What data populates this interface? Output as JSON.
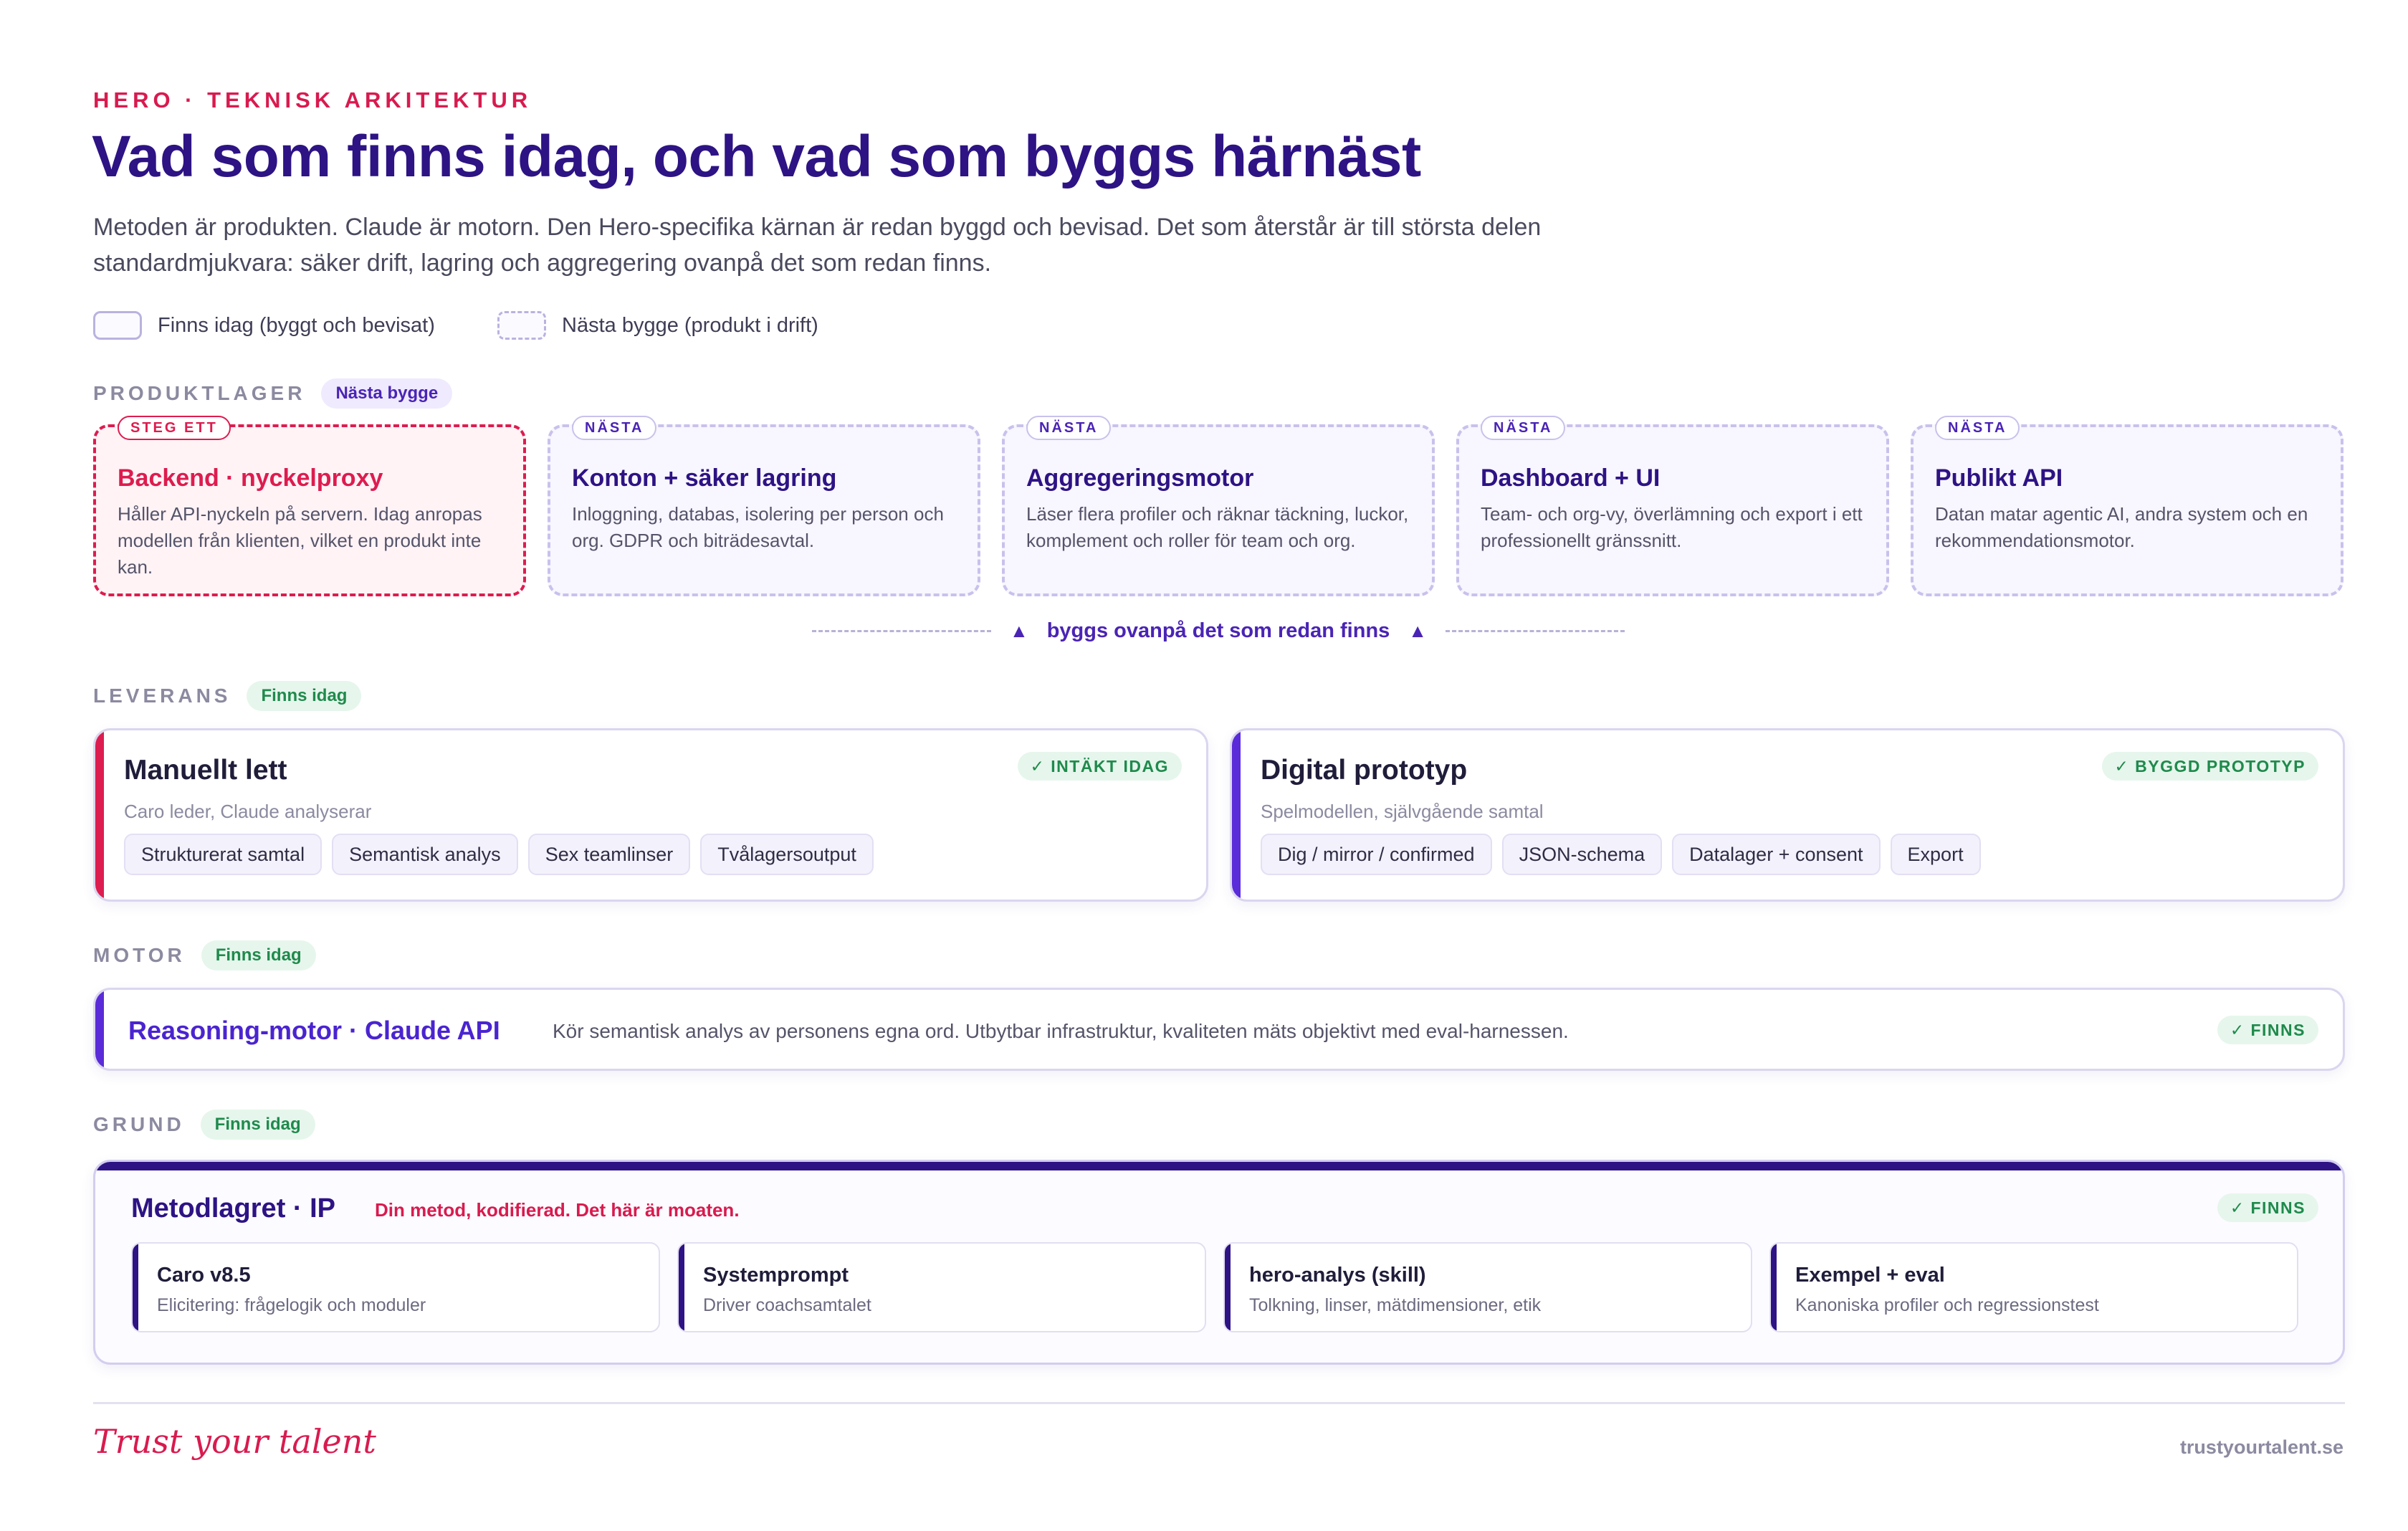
{
  "header": {
    "eyebrow": "HERO · TEKNISK ARKITEKTUR",
    "title": "Vad som finns idag, och vad som byggs härnäst",
    "lead": "Metoden är produkten. Claude är motorn. Den Hero-specifika kärnan är redan byggd och bevisad. Det som återstår är till största delen standardmjukvara: säker drift, lagring och aggregering ovanpå det som redan finns."
  },
  "legend": {
    "exists": "Finns idag (byggt och bevisat)",
    "next": "Nästa bygge (produkt i drift)"
  },
  "product_layer": {
    "label": "PRODUKTLAGER",
    "pill": "Nästa bygge",
    "cards": [
      {
        "tag": "STEG ETT",
        "title": "Backend · nyckelproxy",
        "desc": "Håller API-nyckeln på servern. Idag anropas modellen från klienten, vilket en produkt inte kan."
      },
      {
        "tag": "NÄSTA",
        "title": "Konton + säker lagring",
        "desc": "Inloggning, databas, isolering per person och org. GDPR och biträdesavtal."
      },
      {
        "tag": "NÄSTA",
        "title": "Aggregeringsmotor",
        "desc": "Läser flera profiler och räknar täckning, luckor, komplement och roller för team och org."
      },
      {
        "tag": "NÄSTA",
        "title": "Dashboard + UI",
        "desc": "Team- och org-vy, överlämning och export i ett professionellt gränssnitt."
      },
      {
        "tag": "NÄSTA",
        "title": "Publikt API",
        "desc": "Datan matar agentic AI, andra system och en rekommendationsmotor."
      }
    ],
    "connector": "byggs ovanpå det som redan finns"
  },
  "delivery_layer": {
    "label": "LEVERANS",
    "pill": "Finns idag",
    "cards": [
      {
        "title": "Manuellt lett",
        "sub": "Caro leder, Claude analyserar",
        "status": "✓ INTÄKT IDAG",
        "chips": [
          "Strukturerat samtal",
          "Semantisk analys",
          "Sex teamlinser",
          "Tvålagersoutput"
        ]
      },
      {
        "title": "Digital prototyp",
        "sub": "Spelmodellen, självgående samtal",
        "status": "✓ BYGGD PROTOTYP",
        "chips": [
          "Dig / mirror / confirmed",
          "JSON-schema",
          "Datalager + consent",
          "Export"
        ]
      }
    ]
  },
  "engine_layer": {
    "label": "MOTOR",
    "pill": "Finns idag",
    "title": "Reasoning-motor · Claude API",
    "desc": "Kör semantisk analys av personens egna ord. Utbytbar infrastruktur, kvaliteten mäts objektivt med eval-harnessen.",
    "status": "✓ FINNS"
  },
  "foundation_layer": {
    "label": "GRUND",
    "pill": "Finns idag",
    "title": "Metodlagret · IP",
    "sub": "Din metod, kodifierad. Det här är moaten.",
    "status": "✓ FINNS",
    "items": [
      {
        "title": "Caro v8.5",
        "desc": "Elicitering: frågelogik och moduler"
      },
      {
        "title": "Systemprompt",
        "desc": "Driver coachsamtalet"
      },
      {
        "title": "hero-analys (skill)",
        "desc": "Tolkning, linser, mätdimensioner, etik"
      },
      {
        "title": "Exempel + eval",
        "desc": "Kanoniska profiler och regressionstest"
      }
    ]
  },
  "footer": {
    "signature": "Trust your talent",
    "site": "trustyourtalent.se"
  },
  "colors": {
    "brand_pink": "#d81b4f",
    "brand_purple": "#2d1384",
    "accent_violet": "#5a2bd8",
    "success_green": "#1f8a4c"
  }
}
